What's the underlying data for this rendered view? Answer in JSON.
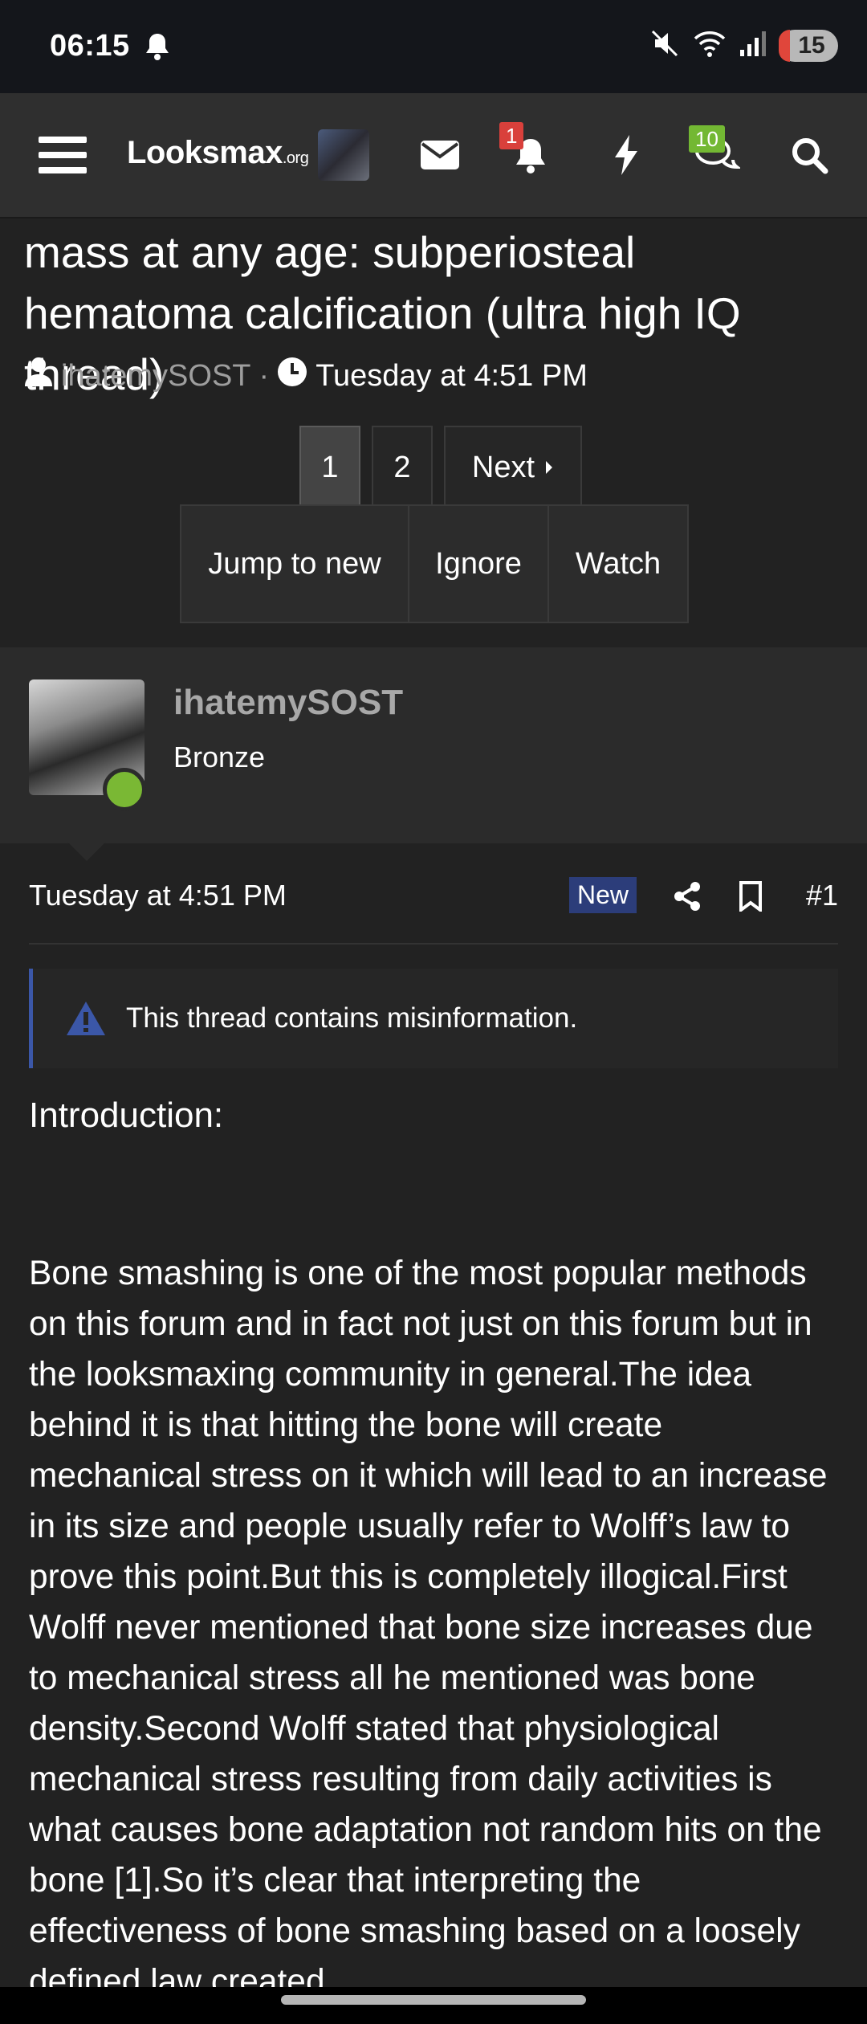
{
  "status": {
    "time": "06:15",
    "battery": "15"
  },
  "nav": {
    "logo_main": "Looksmax",
    "logo_suffix": ".org",
    "alerts_count": "1",
    "conversations_count": "10"
  },
  "thread": {
    "title": "mass at any age: subperiosteal hematoma calcification (ultra high IQ thread)",
    "author": "ihatemySOST",
    "date": "Tuesday at 4:51 PM"
  },
  "pagination": {
    "page1": "1",
    "page2": "2",
    "next": "Next"
  },
  "actions": {
    "jump": "Jump to new",
    "ignore": "Ignore",
    "watch": "Watch"
  },
  "post": {
    "username": "ihatemySOST",
    "user_title": "Bronze",
    "date": "Tuesday at 4:51 PM",
    "new_label": "New",
    "number": "#1",
    "notice": "This thread contains misinformation.",
    "intro": "Introduction:",
    "body": "Bone smashing is one of the most popular methods on this forum and in fact not just on this forum but in the looksmaxing community in general.The idea behind it is that hitting the bone will create mechanical stress on it which will lead to an increase in its size and people usually refer to Wolff’s law to prove this point.But this is completely illogical.First Wolff never mentioned that bone size increases due to mechanical stress all he mentioned was bone density.Second Wolff stated that physiological mechanical stress resulting from daily activities is what causes bone adaptation not random hits on the bone [1].So it’s clear that interpreting the effectiveness of bone smashing based on a loosely defined law created"
  },
  "colors": {
    "page_bg": "#222222",
    "nav_bg": "#2f2f2f",
    "online": "#7ab834",
    "badge_alert": "#d9403b",
    "badge_conv": "#73b833",
    "new_badge": "#2c3d7a"
  }
}
